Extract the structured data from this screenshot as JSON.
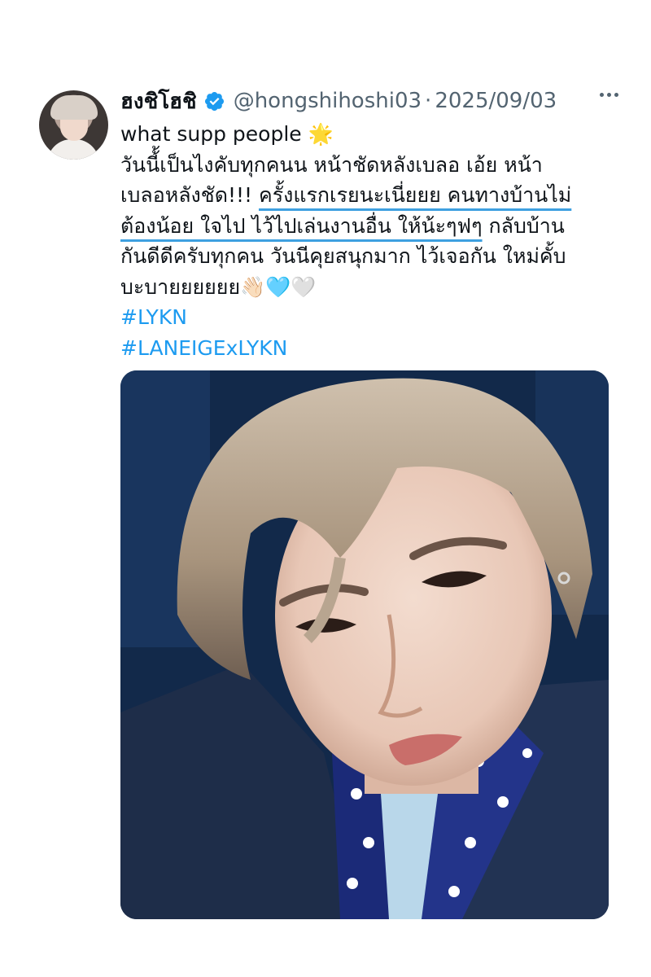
{
  "tweet": {
    "display_name": "ฮงชิโฮชิ",
    "handle": "@hongshihoshi03",
    "separator": "·",
    "date": "2025/09/03",
    "verified": true,
    "text_lines": [
      [
        "what supp people ",
        "🌟"
      ],
      [
        "วันนี้้เป็นไงคับทุกคนน หน้าชัดหลังเบลอ เอ้ย หน้า"
      ],
      [
        "เบลอหลังชัด!!! ",
        "ครั้งแรกเรยนะเนี่ยยย คนทางบ้านไม่"
      ],
      [
        "ต้องน้อย ใจไป ไว้ไปเล่นงานอื่น ให้น้ะๆฟๆ",
        " กลับบ้าน"
      ],
      [
        "กันดีดีครับทุกคน วันนีคุยสนุกมาก ไว้เจอกัน ใหม่คั้บ"
      ],
      [
        "บะบายยยยยย",
        "👋🏻",
        "🩵",
        "🤍"
      ]
    ],
    "hashtags": [
      "#LYKN",
      "#LANEIGExLYKN"
    ]
  },
  "colors": {
    "accent": "#1d9bf0",
    "highlight_underline": "#3ea0e0",
    "secondary_text": "#536471"
  },
  "icons": {
    "verified": "verified-badge-icon",
    "more": "more-options-icon"
  }
}
